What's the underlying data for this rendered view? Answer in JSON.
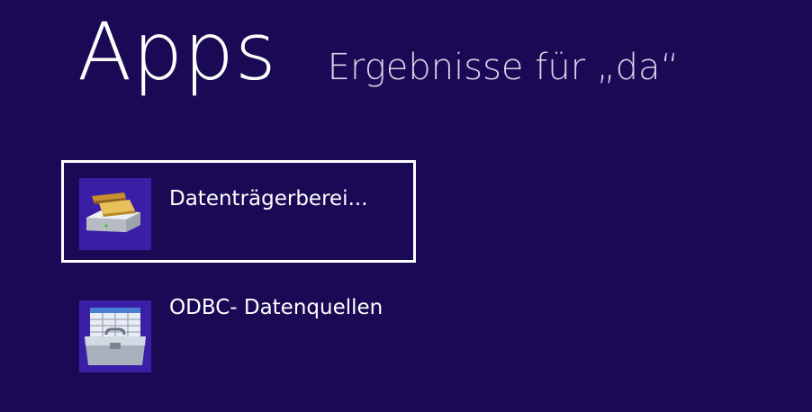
{
  "header": {
    "title": "Apps",
    "subtitle": "Ergebnisse für „da“"
  },
  "results": [
    {
      "label": "Datenträgerberei...",
      "icon": "disk-cleanup-icon",
      "selected": true
    },
    {
      "label": "ODBC- Datenquellen",
      "icon": "odbc-toolbox-icon",
      "selected": false
    }
  ],
  "colors": {
    "background": "#1a0a55",
    "tile": "#3a1fa6",
    "selection_border": "#ffffff"
  }
}
